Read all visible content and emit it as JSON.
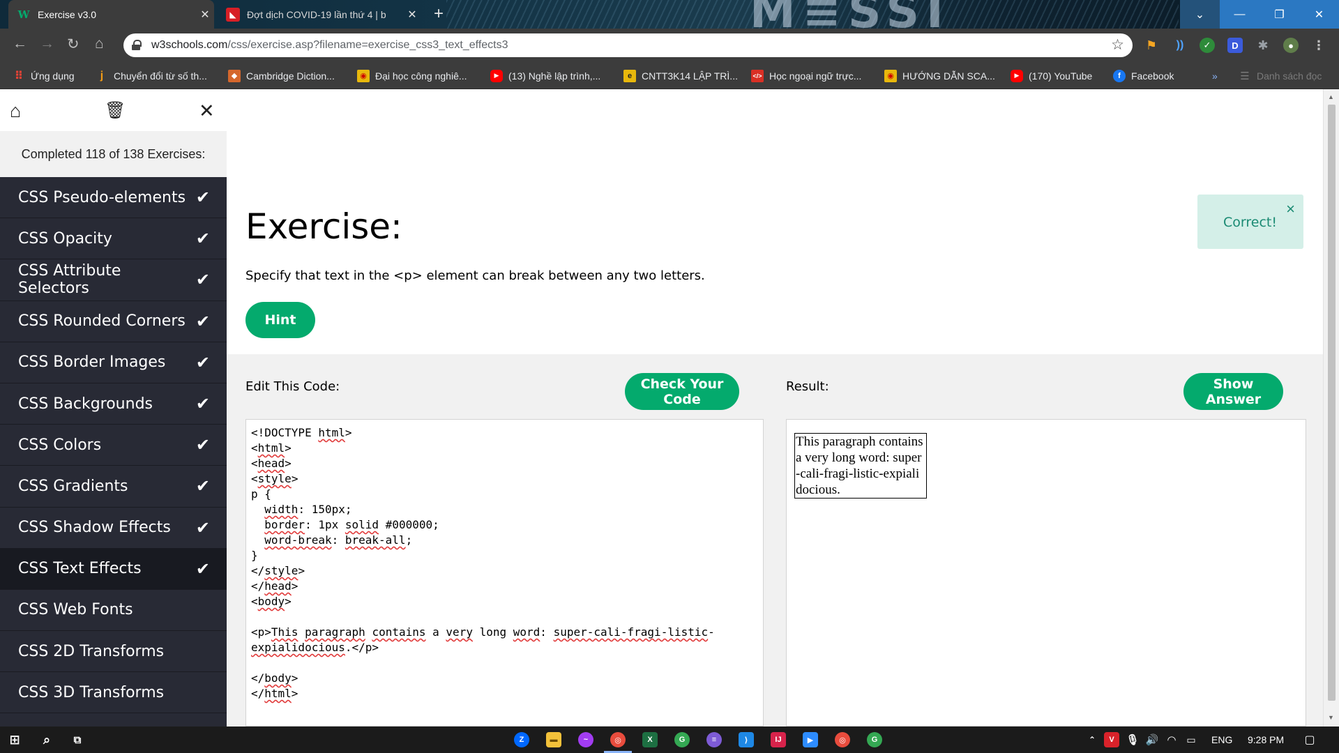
{
  "browser": {
    "tabs": [
      {
        "title": "Exercise v3.0",
        "active": true,
        "icon": "w3schools-icon"
      },
      {
        "title": "Đợt dịch COVID-19 lần thứ 4 | b",
        "active": false,
        "icon": "news-icon"
      }
    ],
    "address": {
      "domain": "w3schools.com",
      "path": "/css/exercise.asp?filename=exercise_css3_text_effects3"
    },
    "bookmarks": [
      {
        "label": "Ứng dụng",
        "color": "#e34133"
      },
      {
        "label": "Chuyển đổi từ số th...",
        "color": "#f29b16"
      },
      {
        "label": "Cambridge Diction...",
        "color": "#d5672c"
      },
      {
        "label": "Đại học công nghiê...",
        "color": "#e8b80c"
      },
      {
        "label": "(13) Nghề lập trình,...",
        "color": "#ff0000"
      },
      {
        "label": "CNTT3K14 LẬP TRÌ...",
        "color": "#e8b80c"
      },
      {
        "label": "Học ngoại ngữ trực...",
        "color": "#d93025"
      },
      {
        "label": "HƯỚNG DẪN SCA...",
        "color": "#e8b80c"
      },
      {
        "label": "(170) YouTube",
        "color": "#ff0000"
      },
      {
        "label": "Facebook",
        "color": "#1877f2"
      }
    ],
    "bookmarks_more": "»",
    "reading_list": "Danh sách đọc"
  },
  "sidebar": {
    "completed_text": "Completed 118 of 138 Exercises:",
    "items": [
      {
        "label": "CSS Pseudo-elements",
        "done": "✔"
      },
      {
        "label": "CSS Opacity",
        "done": "✔"
      },
      {
        "label": "CSS Attribute Selectors",
        "done": "✔"
      },
      {
        "label": "CSS Rounded Corners",
        "done": "✔"
      },
      {
        "label": "CSS Border Images",
        "done": "✔"
      },
      {
        "label": "CSS Backgrounds",
        "done": "✔"
      },
      {
        "label": "CSS Colors",
        "done": "✔"
      },
      {
        "label": "CSS Gradients",
        "done": "✔"
      },
      {
        "label": "CSS Shadow Effects",
        "done": "✔"
      },
      {
        "label": "CSS Text Effects",
        "done": "✔"
      },
      {
        "label": "CSS Web Fonts",
        "done": ""
      },
      {
        "label": "CSS 2D Transforms",
        "done": ""
      },
      {
        "label": "CSS 3D Transforms",
        "done": ""
      }
    ]
  },
  "exercise": {
    "title": "Exercise:",
    "instruction": "Specify that text in the <p> element can break between any two letters.",
    "hint_label": "Hint",
    "toast_text": "Correct!",
    "toast_close": "×",
    "edit_label": "Edit This Code:",
    "check_label": "Check Your Code",
    "result_label": "Result:",
    "answer_label": "Show Answer",
    "code_lines": [
      "<!DOCTYPE html>",
      "<html>",
      "<head>",
      "<style>",
      "p {",
      "  width: 150px;",
      "  border: 1px solid #000000;",
      "  word-break: break-all;",
      "}",
      "</style>",
      "</head>",
      "<body>",
      "",
      "<p>This paragraph contains a very long word: super-cali-fragi-listic-",
      "expialidocious.</p>",
      "",
      "</body>",
      "</html>"
    ],
    "result_text": "This paragraph contains a very long word: super-cali-fragi-listic-expialidocious."
  },
  "taskbar": {
    "language": "ENG",
    "time": "9:28 PM"
  },
  "colors": {
    "accent": "#04aa6d",
    "sidebar_bg": "#282a35",
    "toast_bg": "#d4efe8"
  }
}
